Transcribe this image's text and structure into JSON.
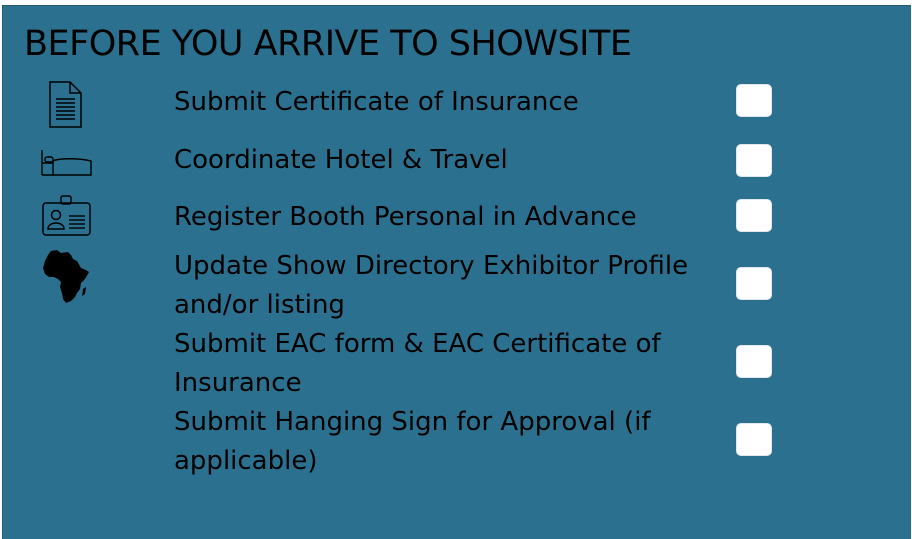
{
  "panel": {
    "title": "BEFORE YOU ARRIVE TO SHOWSITE",
    "background_color": "#2b718f"
  },
  "checklist": [
    {
      "label": "Submit Certificate of Insurance",
      "icon": "document-icon",
      "checked": false
    },
    {
      "label": "Coordinate Hotel & Travel",
      "icon": "bed-icon",
      "checked": false
    },
    {
      "label": "Register Booth Personal in Advance",
      "icon": "id-badge-icon",
      "checked": false
    },
    {
      "label": "Update Show Directory Exhibitor Profile and/or listing",
      "icon": "africa-map-icon",
      "checked": false
    },
    {
      "label": "Submit EAC form & EAC Certificate of Insurance",
      "checked": false
    },
    {
      "label": "Submit Hanging Sign for Approval (if applicable)",
      "checked": false
    }
  ]
}
